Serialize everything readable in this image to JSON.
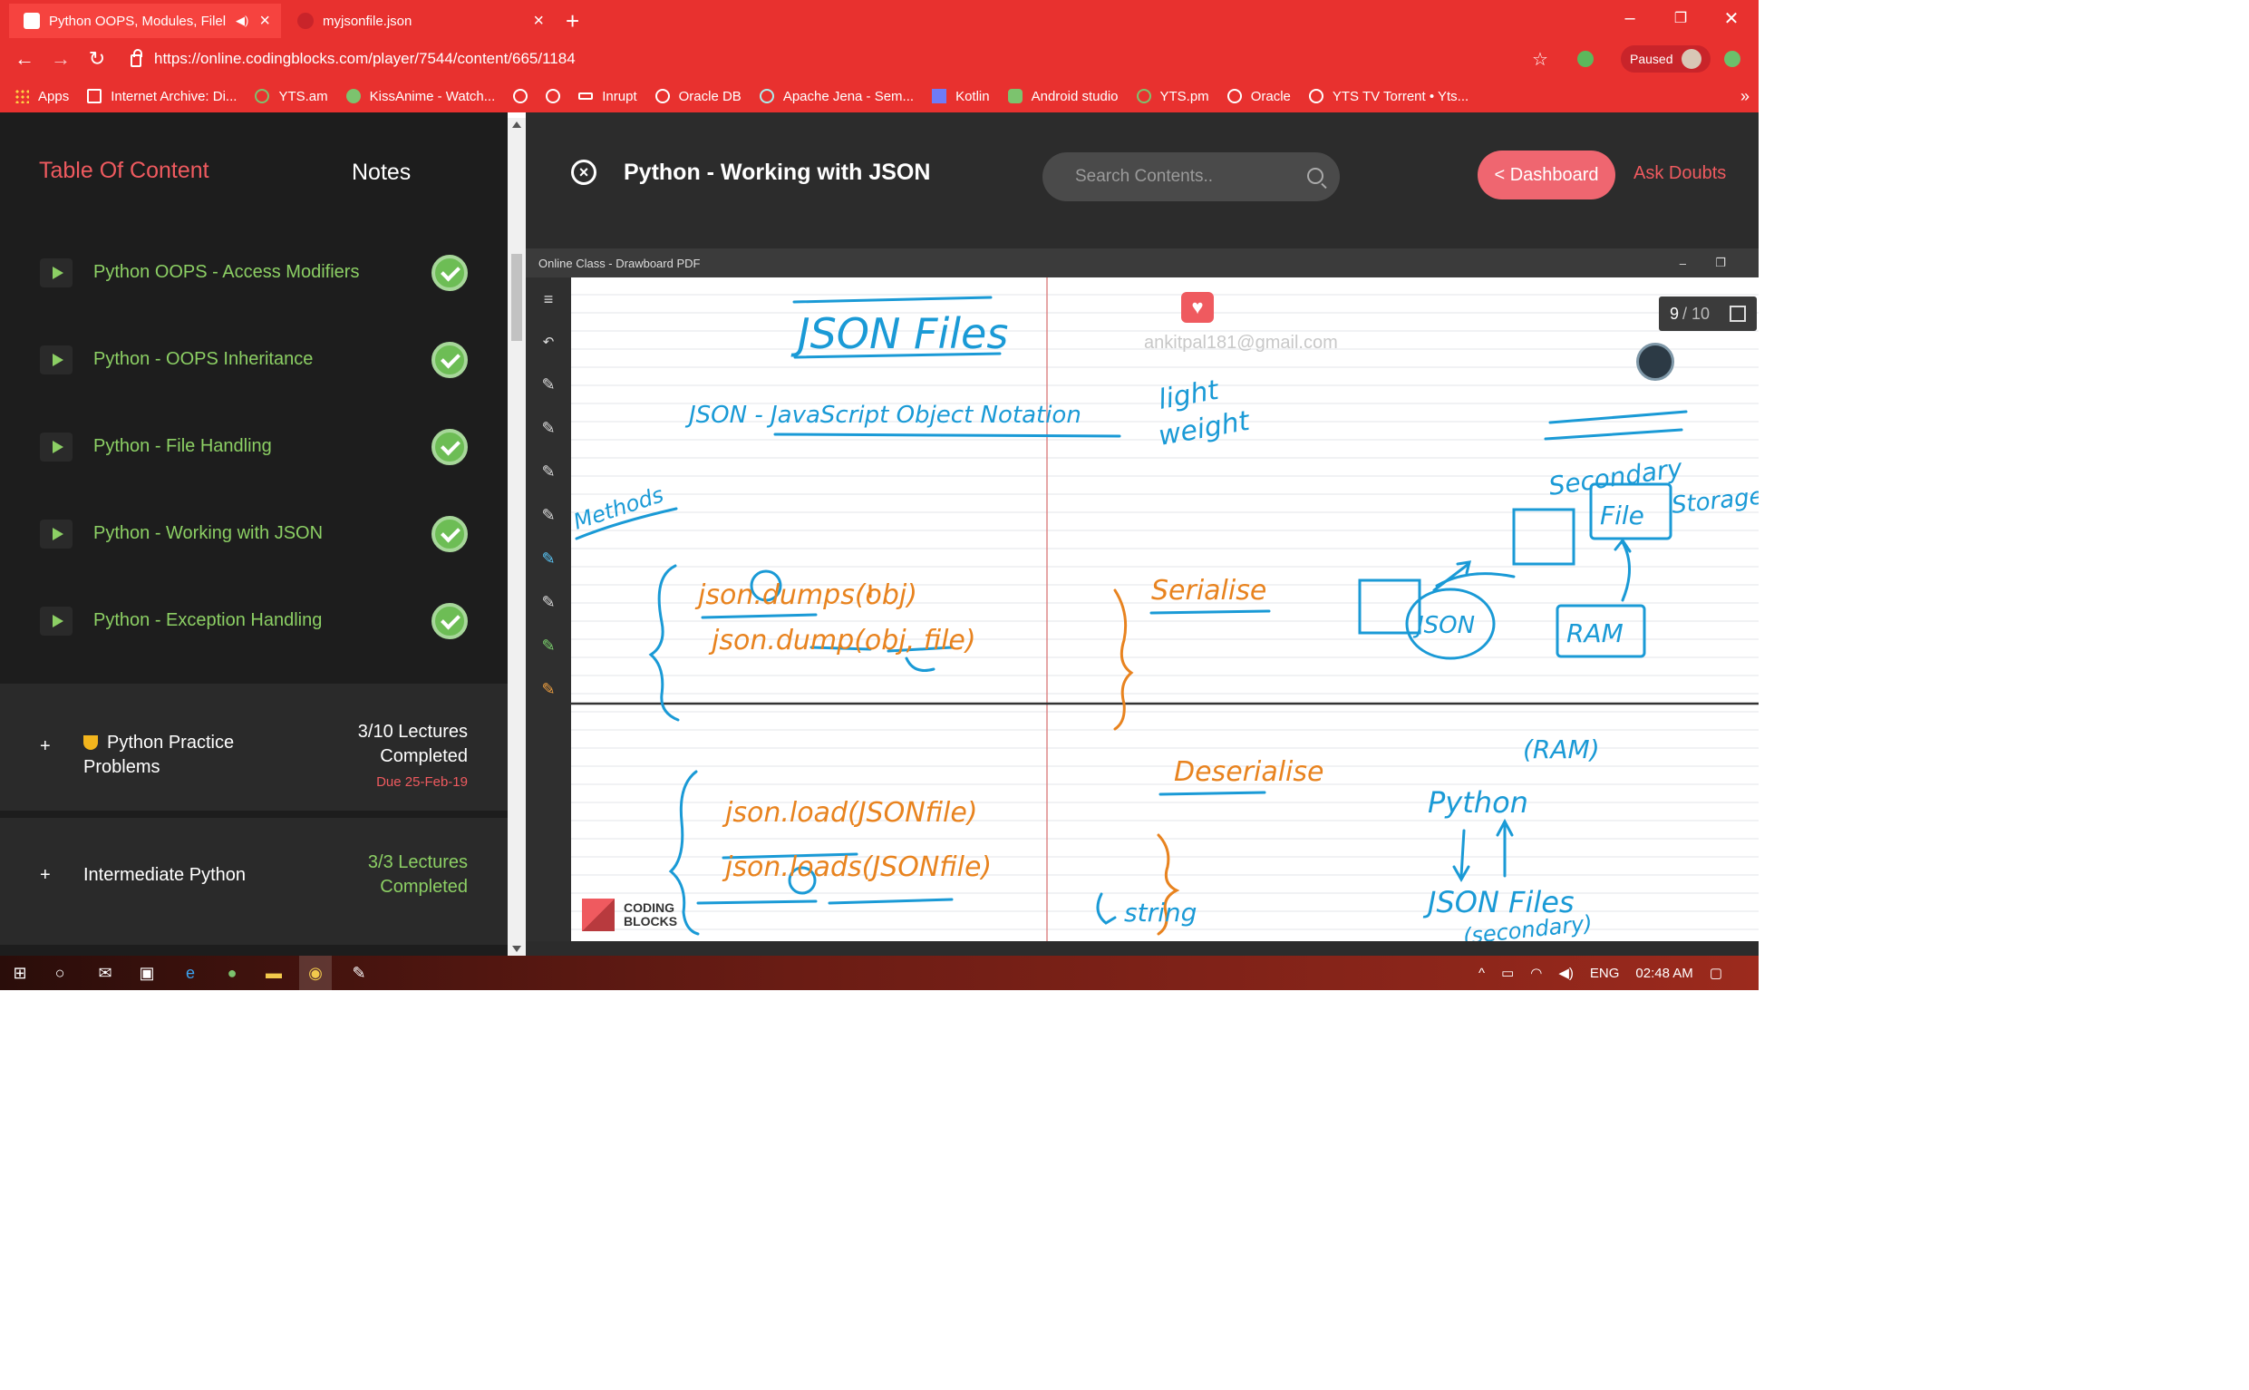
{
  "browser": {
    "tabs": [
      {
        "title": "Python OOPS, Modules, Filel",
        "active": true
      },
      {
        "title": "myjsonfile.json",
        "active": false
      }
    ],
    "url": "https://online.codingblocks.com/player/7544/content/665/1184",
    "paused_label": "Paused",
    "bookmarks": [
      {
        "label": "Apps",
        "icon": "apps-grid-icon"
      },
      {
        "label": "Internet Archive: Di...",
        "icon": "archive-icon"
      },
      {
        "label": "YTS.am",
        "icon": "yts-icon"
      },
      {
        "label": "KissAnime - Watch...",
        "icon": "kissanime-icon"
      },
      {
        "label": "",
        "icon": "globe-icon"
      },
      {
        "label": "",
        "icon": "globe-icon"
      },
      {
        "label": "Inrupt",
        "icon": "inrupt-icon"
      },
      {
        "label": "Oracle DB",
        "icon": "globe-icon"
      },
      {
        "label": "Apache Jena - Sem...",
        "icon": "jena-icon"
      },
      {
        "label": "Kotlin",
        "icon": "kotlin-icon"
      },
      {
        "label": "Android studio",
        "icon": "android-icon"
      },
      {
        "label": "YTS.pm",
        "icon": "yts-icon"
      },
      {
        "label": "Oracle",
        "icon": "globe-icon"
      },
      {
        "label": "YTS TV Torrent • Yts...",
        "icon": "globe-icon"
      }
    ],
    "more_label": "»"
  },
  "sidebar": {
    "tab_toc": "Table Of Content",
    "tab_notes": "Notes",
    "lessons": [
      {
        "label": "Python OOPS - Access Modifiers",
        "completed": true
      },
      {
        "label": "Python - OOPS Inheritance",
        "completed": true
      },
      {
        "label": "Python - File Handling",
        "completed": true
      },
      {
        "label": "Python - Working with JSON",
        "completed": true
      },
      {
        "label": "Python - Exception Handling",
        "completed": true
      }
    ],
    "sections": [
      {
        "title_line1": "Python Practice",
        "title_line2": "Problems",
        "count_line1": "3/10 Lectures",
        "count_line2": "Completed",
        "due": "Due 25-Feb-19",
        "count_color": "#ffffff"
      },
      {
        "title_line1": "Intermediate Python",
        "count_line1": "3/3 Lectures",
        "count_line2": "Completed",
        "count_color": "#8ccf64"
      }
    ]
  },
  "header": {
    "title": "Python - Working with JSON",
    "search_placeholder": "Search Contents..",
    "dashboard_label": "< Dashboard",
    "ask_doubts_label": "Ask Doubts"
  },
  "viewer": {
    "window_title": "Online Class - Drawboard PDF",
    "page_current": "9",
    "page_total": "/ 10",
    "watermark": "ankitpal181@gmail.com",
    "logo_line1": "CODING",
    "logo_line2": "BLOCKS"
  },
  "whiteboard": {
    "heading": "JSON Files",
    "definition": "JSON - JavaScript Object Notation",
    "light": "light",
    "weight": "weight",
    "methods": "Methods",
    "m1": "json.dumps(obj)",
    "m2": "json.dump(obj, file)",
    "serialise": "Serialise",
    "m3": "json.load(JSONfile)",
    "m4": "json.loads(JSONfile)",
    "deserialise": "Deserialise",
    "string": "string",
    "secondary": "Secondary",
    "storage": "Storage",
    "file": "File",
    "json": "JSON",
    "ram": "RAM",
    "ram_paren": "(RAM)",
    "python": "Python",
    "json_files": "JSON Files",
    "secondary_paren": "(secondary)"
  },
  "taskbar": {
    "lang": "ENG",
    "time": "02:48 AM"
  },
  "colors": {
    "chrome_red": "#e8312f",
    "accent": "#ef5a5f",
    "lesson_green": "#8ccf64",
    "ink_blue": "#1a9ad6",
    "ink_orange": "#e8831f"
  }
}
